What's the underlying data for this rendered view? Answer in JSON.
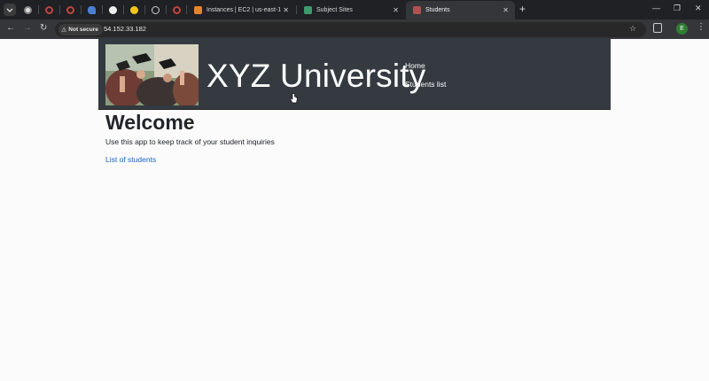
{
  "browser": {
    "tabs": [
      {
        "title": "Instances | EC2 | us-east-1",
        "favicon_color": "#e8822a"
      },
      {
        "title": "Subject Sites",
        "favicon_color": "#3c9b6e"
      },
      {
        "title": "Students",
        "favicon_color": "#b0514f"
      }
    ],
    "pinned_icons": [
      "chrome-icon",
      "target-icon",
      "target-icon",
      "rocket-icon",
      "github-icon",
      "bitmoji-icon",
      "globe-icon",
      "target-icon"
    ],
    "security_label": "Not secure",
    "url": "54.152.33.182",
    "profile_initial": "E"
  },
  "header": {
    "brand": "XYZ University",
    "nav": [
      {
        "label": "Home"
      },
      {
        "label": "Students list"
      }
    ]
  },
  "main": {
    "title": "Welcome",
    "intro": "Use this app to keep track of your student inquiries",
    "link": "List of students"
  }
}
